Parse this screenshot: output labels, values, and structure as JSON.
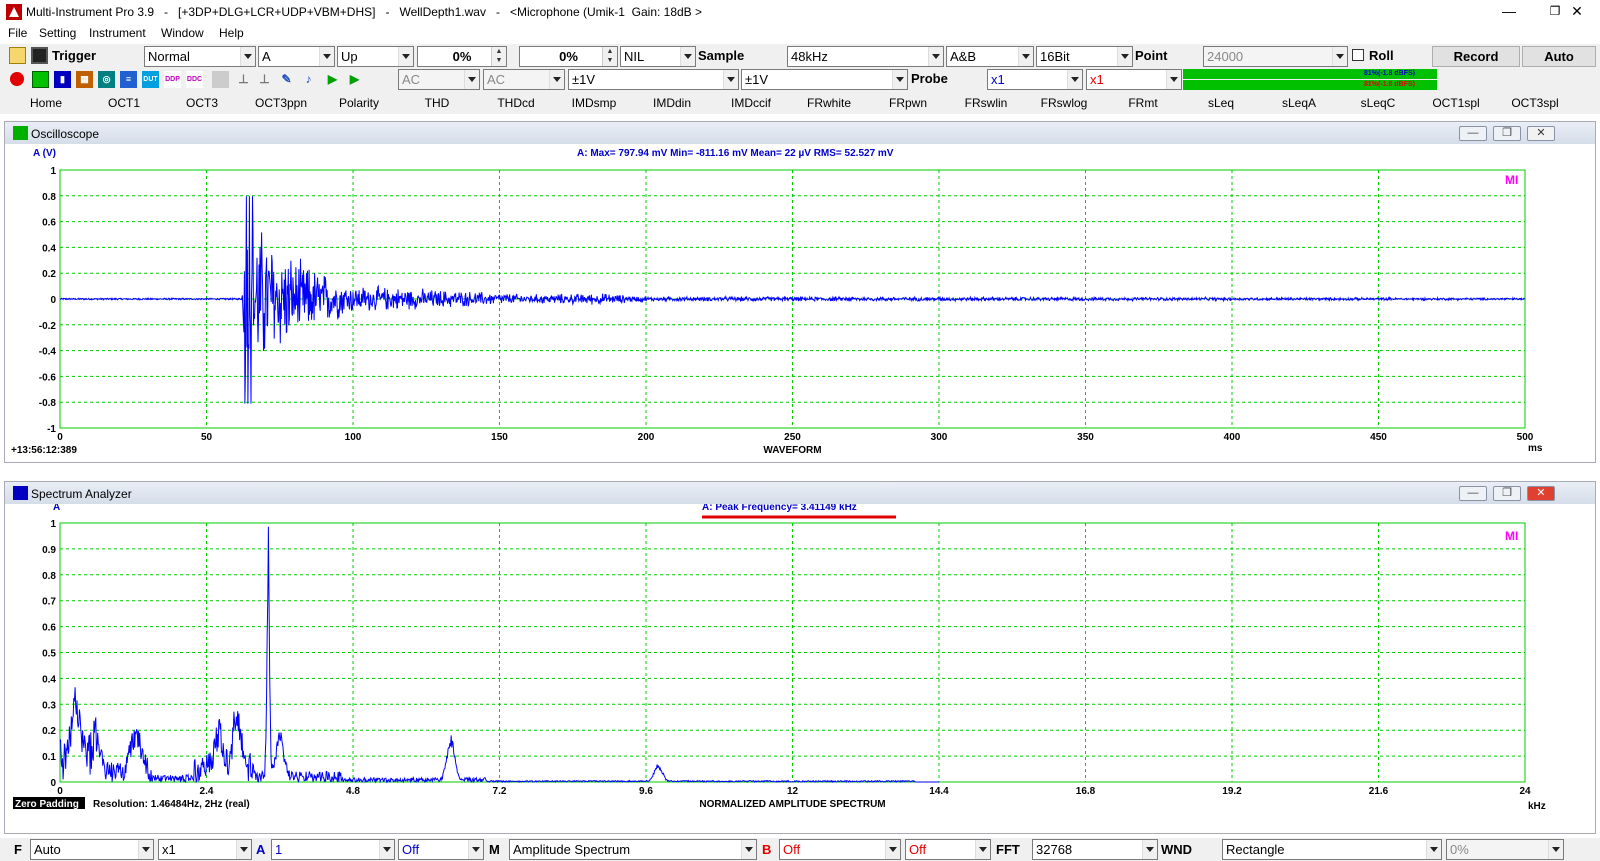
{
  "titlebar": {
    "title": "Multi-Instrument Pro 3.9   -   [+3DP+DLG+LCR+UDP+VBM+DHS]   -   WellDepth1.wav   -   <Microphone (Umik-1  Gain: 18dB >",
    "minimize": "—",
    "restore": "❐",
    "close": "✕"
  },
  "menu": [
    "File",
    "Setting",
    "Instrument",
    "Window",
    "Help"
  ],
  "toolbar1": {
    "trigger_label": "Trigger",
    "trigger_mode": "Normal",
    "trigger_channel": "A",
    "trigger_edge": "Up",
    "trigger_level": "0%",
    "trigger_delay": "0%",
    "nil": "NIL",
    "sample_label": "Sample",
    "sample_rate": "48kHz",
    "channels": "A&B",
    "bits": "16Bit",
    "point_label": "Point",
    "point_value": "24000",
    "roll_label": "Roll",
    "record_label": "Record",
    "auto_label": "Auto"
  },
  "toolbar2": {
    "coupling_a": "AC",
    "coupling_b": "AC",
    "range_a": "±1V",
    "range_b": "±1V",
    "probe_label": "Probe",
    "probe_a": "x1",
    "probe_b": "x1",
    "level_a": "81%(-1.8 dBFS)",
    "level_b": "81%(-1.8 dBFS)",
    "level_fraction": 0.81
  },
  "tabs": [
    "Home",
    "OCT1",
    "OCT3",
    "OCT3ppn",
    "Polarity",
    "THD",
    "THDcd",
    "IMDsmp",
    "IMDdin",
    "IMDccif",
    "FRwhite",
    "FRpwn",
    "FRswlin",
    "FRswlog",
    "FRmt",
    "sLeq",
    "sLeqA",
    "sLeqC",
    "OCT1spl",
    "OCT3spl"
  ],
  "oscilloscope": {
    "title": "Oscilloscope",
    "unit_label": "A (V)",
    "stats": "A: Max=    797.94  mV  Min=   -811.16  mV  Mean=          22   µV  RMS=       52.527  mV",
    "timestamp": "+13:56:12:389",
    "xlabel": "WAVEFORM",
    "xunit": "ms",
    "mi_logo": "MI"
  },
  "spectrum": {
    "title": "Spectrum Analyzer",
    "unit_label": "A",
    "peak": "A: Peak Frequency=    3.41149   kHz",
    "zero_padding": "Zero Padding",
    "resolution": "Resolution: 1.46484Hz, 2Hz (real)",
    "xlabel": "NORMALIZED AMPLITUDE SPECTRUM",
    "xunit": "kHz",
    "mi_logo": "MI"
  },
  "bottombar": {
    "f_label": "F",
    "f_value": "Auto",
    "zoom": "x1",
    "a_label": "A",
    "a_value": "1",
    "a_opt": "Off",
    "m_label": "M",
    "m_value": "Amplitude Spectrum",
    "b_label": "B",
    "b_value": "Off",
    "b_opt": "Off",
    "fft_label": "FFT",
    "fft_value": "32768",
    "wnd_label": "WND",
    "wnd_value": "Rectangle",
    "overlap": "0%"
  },
  "colors": {
    "trace": "#0000ff",
    "grid": "#00cc00",
    "accent_red": "#e00000",
    "mi_logo": "#ff00ff"
  },
  "chart_data": [
    {
      "type": "line",
      "title": "",
      "xlabel": "WAVEFORM",
      "ylabel": "A (V)",
      "xlim": [
        0,
        500
      ],
      "ylim": [
        -1,
        1
      ],
      "x_ticks": [
        0,
        50,
        100,
        150,
        200,
        250,
        300,
        350,
        400,
        450,
        500
      ],
      "y_ticks": [
        1,
        0.8,
        0.6,
        0.4,
        0.2,
        0,
        -0.2,
        -0.4,
        -0.6,
        -0.8,
        -1
      ],
      "grid": true,
      "envelope_points": [
        {
          "x": 0,
          "amp": 0.03
        },
        {
          "x": 62,
          "amp": 0.03
        },
        {
          "x": 63,
          "amp": 0.8
        },
        {
          "x": 70,
          "amp": 0.6
        },
        {
          "x": 80,
          "amp": 0.35
        },
        {
          "x": 100,
          "amp": 0.12
        },
        {
          "x": 130,
          "amp": 0.08
        },
        {
          "x": 160,
          "amp": 0.04
        },
        {
          "x": 185,
          "amp": 0.05
        },
        {
          "x": 200,
          "amp": 0.02
        },
        {
          "x": 250,
          "amp": 0.02
        },
        {
          "x": 500,
          "amp": 0.01
        }
      ],
      "series": [
        {
          "name": "A",
          "stats": {
            "max_mV": 797.94,
            "min_mV": -811.16,
            "mean_uV": 22,
            "rms_mV": 52.527
          }
        }
      ]
    },
    {
      "type": "line",
      "title": "",
      "xlabel": "NORMALIZED AMPLITUDE SPECTRUM",
      "ylabel": "A",
      "xlim": [
        0,
        24
      ],
      "ylim": [
        0,
        1
      ],
      "x_ticks": [
        "0",
        "2.4",
        "4.8",
        "7.2",
        "9.6",
        "12",
        "14.4",
        "16.8",
        "19.2",
        "21.6",
        "24"
      ],
      "y_ticks": [
        1,
        0.9,
        0.8,
        0.7,
        0.6,
        0.5,
        0.4,
        0.3,
        0.2,
        0.1,
        0
      ],
      "grid": true,
      "peaks": [
        {
          "x": 0.25,
          "y": 0.28
        },
        {
          "x": 0.6,
          "y": 0.15
        },
        {
          "x": 1.2,
          "y": 0.12
        },
        {
          "x": 1.3,
          "y": 0.11
        },
        {
          "x": 2.6,
          "y": 0.15
        },
        {
          "x": 2.9,
          "y": 0.25
        },
        {
          "x": 3.41149,
          "y": 1.0
        },
        {
          "x": 3.6,
          "y": 0.18
        },
        {
          "x": 6.4,
          "y": 0.17
        },
        {
          "x": 9.8,
          "y": 0.07
        }
      ]
    }
  ]
}
